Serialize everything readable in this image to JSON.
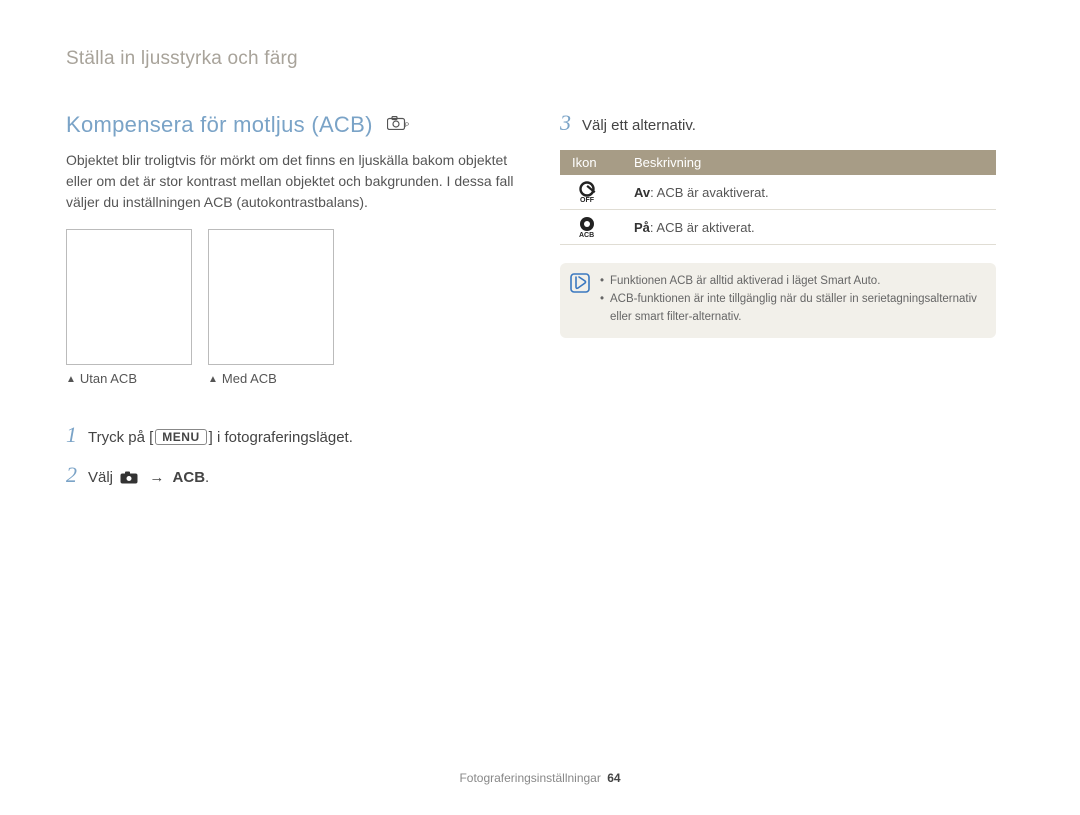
{
  "header": "Ställa in ljusstyrka och färg",
  "left": {
    "title": "Kompensera för motljus (ACB)",
    "body": "Objektet blir troligtvis för mörkt om det finns en ljuskälla bakom objektet eller om det är stor kontrast mellan objektet och bakgrunden. I dessa fall väljer du inställningen ACB (autokontrastbalans).",
    "caption_without": "Utan ACB",
    "caption_with": "Med ACB",
    "step1_a": "Tryck på [",
    "step1_menu": "MENU",
    "step1_b": "] i fotograferingsläget.",
    "step2_pre": "Välj",
    "step2_post": "ACB",
    "step2_suffix": "."
  },
  "right": {
    "step3": "Välj ett alternativ.",
    "table": {
      "h_icon": "Ikon",
      "h_desc": "Beskrivning",
      "row1_label": "Av",
      "row1_text": ": ACB är avaktiverat.",
      "row2_label": "På",
      "row2_text": ": ACB är aktiverat."
    },
    "notes": {
      "n1": "Funktionen ACB är alltid aktiverad i läget Smart Auto.",
      "n2": "ACB-funktionen är inte tillgänglig när du ställer in serietagningsalternativ eller smart filter-alternativ."
    }
  },
  "footer": {
    "section": "Fotograferingsinställningar",
    "page": "64"
  }
}
